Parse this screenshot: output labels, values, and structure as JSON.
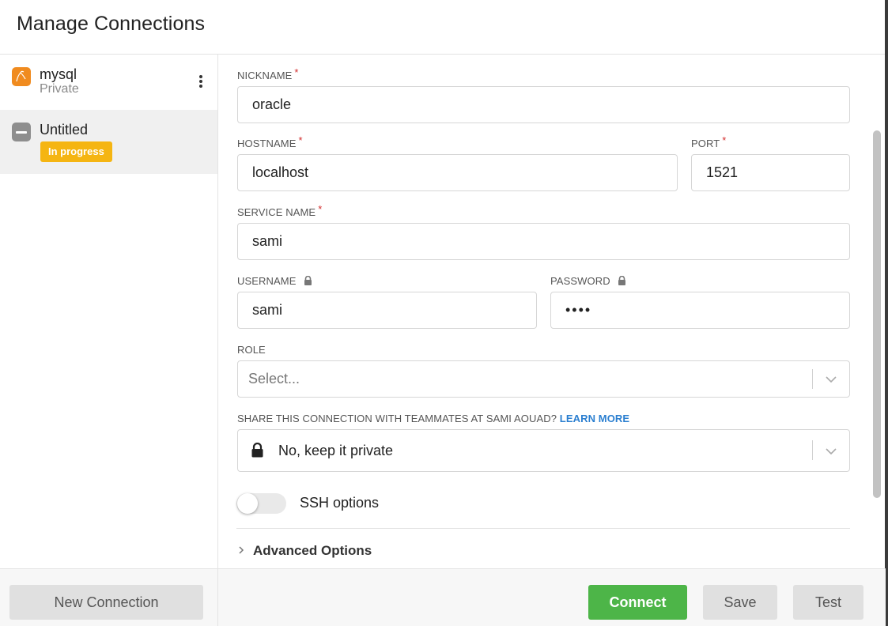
{
  "header": {
    "title": "Manage Connections"
  },
  "sidebar": {
    "connections": [
      {
        "name": "mysql",
        "subtitle": "Private"
      },
      {
        "name": "Untitled",
        "badge": "In progress"
      }
    ],
    "new_connection_label": "New Connection"
  },
  "form": {
    "nickname": {
      "label": "NICKNAME",
      "value": "oracle"
    },
    "hostname": {
      "label": "HOSTNAME",
      "value": "localhost"
    },
    "port": {
      "label": "PORT",
      "value": "1521"
    },
    "service_name": {
      "label": "SERVICE NAME",
      "value": "sami"
    },
    "username": {
      "label": "USERNAME",
      "value": "sami"
    },
    "password": {
      "label": "PASSWORD",
      "value": "••••"
    },
    "role": {
      "label": "ROLE",
      "placeholder": "Select..."
    },
    "share": {
      "label": "SHARE THIS CONNECTION WITH TEAMMATES AT SAMI AOUAD?",
      "link": "LEARN MORE",
      "value": "No, keep it private"
    },
    "ssh_label": "SSH options",
    "advanced_label": "Advanced Options",
    "required_mark": "*"
  },
  "footer": {
    "connect_label": "Connect",
    "save_label": "Save",
    "test_label": "Test"
  },
  "colors": {
    "connect": "#4db548",
    "badge": "#f5b512",
    "link": "#2b7fd0",
    "mysql_icon": "#f08b1f"
  },
  "icons": [
    "mysql-icon",
    "untitled-db-icon",
    "kebab-menu-icon",
    "lock-icon",
    "chevron-down-icon",
    "chevron-right-icon"
  ]
}
